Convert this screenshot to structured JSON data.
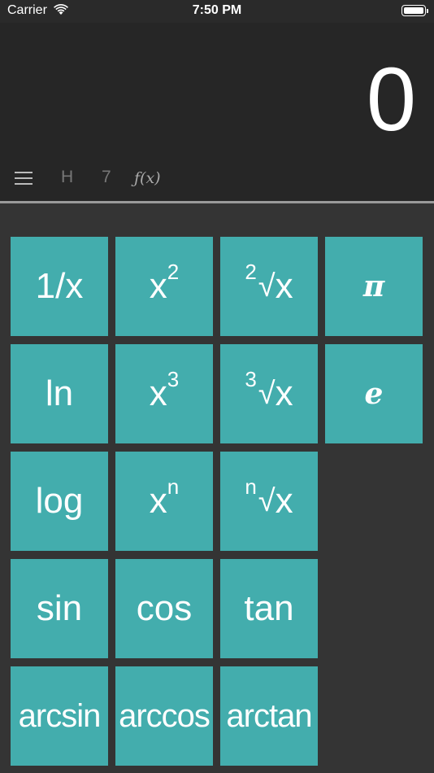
{
  "status_bar": {
    "carrier": "Carrier",
    "time": "7:50 PM"
  },
  "display": {
    "value": "0"
  },
  "toolbar": {
    "h_label": "H",
    "seven_label": "7",
    "fx_label": "ƒ(x)"
  },
  "keys": {
    "reciprocal": "1/x",
    "square_base": "x",
    "square_exp": "2",
    "sqrt_index": "2",
    "sqrt_sign": "√",
    "sqrt_var": "x",
    "pi": "π",
    "ln": "ln",
    "cube_base": "x",
    "cube_exp": "3",
    "cbrt_index": "3",
    "cbrt_sign": "√",
    "cbrt_var": "x",
    "e": "e",
    "log": "log",
    "pow_base": "x",
    "pow_exp": "n",
    "nroot_index": "n",
    "nroot_sign": "√",
    "nroot_var": "x",
    "sin": "sin",
    "cos": "cos",
    "tan": "tan",
    "arcsin": "arcsin",
    "arccos": "arccos",
    "arctan": "arctan"
  }
}
